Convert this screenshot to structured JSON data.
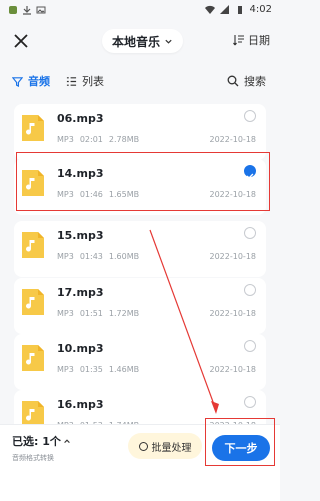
{
  "status": {
    "time": "4:02"
  },
  "header": {
    "source_label": "本地音乐",
    "sort_label": "日期"
  },
  "tabs": {
    "audio": "音频",
    "list": "列表",
    "search": "搜索"
  },
  "files": [
    {
      "name": "06.mp3",
      "format": "MP3",
      "duration": "02:01",
      "size": "2.78MB",
      "date": "2022-10-18",
      "selected": false
    },
    {
      "name": "14.mp3",
      "format": "MP3",
      "duration": "01:46",
      "size": "1.65MB",
      "date": "2022-10-18",
      "selected": true
    },
    {
      "name": "15.mp3",
      "format": "MP3",
      "duration": "01:43",
      "size": "1.60MB",
      "date": "2022-10-18",
      "selected": false
    },
    {
      "name": "17.mp3",
      "format": "MP3",
      "duration": "01:51",
      "size": "1.72MB",
      "date": "2022-10-18",
      "selected": false
    },
    {
      "name": "10.mp3",
      "format": "MP3",
      "duration": "01:35",
      "size": "1.46MB",
      "date": "2022-10-18",
      "selected": false
    },
    {
      "name": "16.mp3",
      "format": "MP3",
      "duration": "01:53",
      "size": "1.74MB",
      "date": "2022-10-18",
      "selected": false
    },
    {
      "name": "04.mp3",
      "format": "",
      "duration": "",
      "size": "",
      "date": "",
      "selected": false
    }
  ],
  "bottom": {
    "selected_count": "已选: 1个",
    "sub_label": "音频格式转换",
    "batch_label": "批量处理",
    "next_label": "下一步"
  },
  "colors": {
    "accent": "#1a73e8",
    "annotation": "#e53935",
    "thumb": "#f7c948"
  }
}
